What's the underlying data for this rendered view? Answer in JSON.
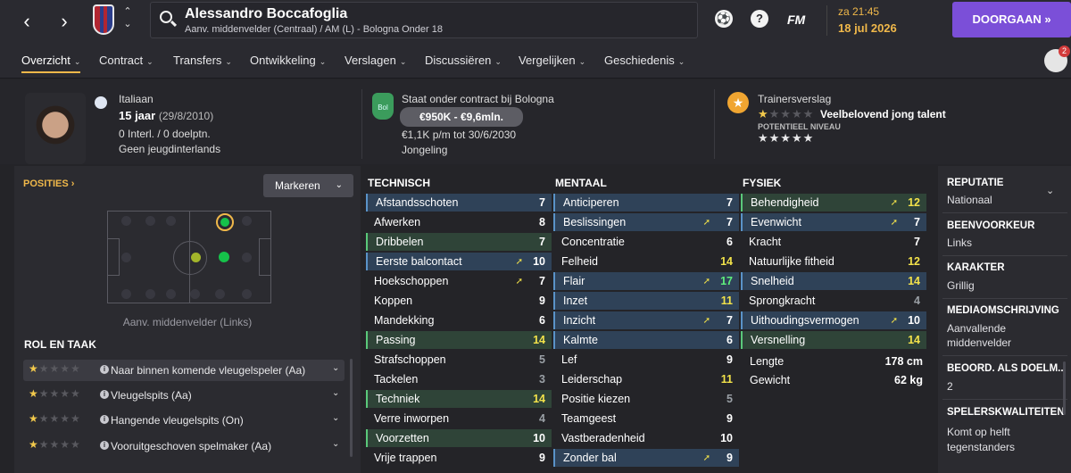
{
  "header": {
    "player_name": "Alessandro Boccafoglia",
    "player_sub": "Aanv. middenvelder (Centraal) / AM (L) - Bologna Onder 18",
    "fm_label": "FM",
    "time": "za 21:45",
    "date": "18 jul 2026",
    "continue_label": "DOORGAAN",
    "help_label": "?"
  },
  "menu": [
    {
      "label": "Overzicht"
    },
    {
      "label": "Contract"
    },
    {
      "label": "Transfers"
    },
    {
      "label": "Ontwikkeling"
    },
    {
      "label": "Verslagen"
    },
    {
      "label": "Discussiëren"
    },
    {
      "label": "Vergelijken"
    },
    {
      "label": "Geschiedenis"
    }
  ],
  "notifications_count": "2",
  "info": {
    "nationality": "Italiaan",
    "age": "15 jaar",
    "dob": "(29/8/2010)",
    "caps": "0 Interl. / 0 doelptn.",
    "youth": "Geen jeugdinterlands",
    "contract_status": "Staat onder contract bij Bologna",
    "club_short": "Bol",
    "value_range": "€950K - €9,6mln.",
    "wage": "€1,1K p/m tot 30/6/2030",
    "contract_type": "Jongeling",
    "coach_report_title": "Trainersverslag",
    "coach_report_text": "Veelbelovend jong talent",
    "potential_label": "POTENTIEEL NIVEAU",
    "current_ability_stars": 1.5,
    "potential_stars": 4.5
  },
  "positions": {
    "title": "POSITIES",
    "mark_button": "Markeren",
    "caption": "Aanv. middenvelder (Links)"
  },
  "roles": {
    "title": "ROL EN TAAK",
    "items": [
      {
        "label": "Naar binnen komende vleugelspeler (Aa)",
        "stars": 1.5
      },
      {
        "label": "Vleugelspits (Aa)",
        "stars": 1.5
      },
      {
        "label": "Hangende vleugelspits (On)",
        "stars": 1
      },
      {
        "label": "Vooruitgeschoven spelmaker (Aa)",
        "stars": 1
      }
    ]
  },
  "attributes": {
    "technical_title": "TECHNISCH",
    "mental_title": "MENTAAL",
    "physical_title": "FYSIEK",
    "technical": [
      {
        "name": "Afstandsschoten",
        "value": "7"
      },
      {
        "name": "Afwerken",
        "value": "8"
      },
      {
        "name": "Dribbelen",
        "value": "7"
      },
      {
        "name": "Eerste balcontact",
        "value": "10"
      },
      {
        "name": "Hoekschoppen",
        "value": "7"
      },
      {
        "name": "Koppen",
        "value": "9"
      },
      {
        "name": "Mandekking",
        "value": "6"
      },
      {
        "name": "Passing",
        "value": "14"
      },
      {
        "name": "Strafschoppen",
        "value": "5"
      },
      {
        "name": "Tackelen",
        "value": "3"
      },
      {
        "name": "Techniek",
        "value": "14"
      },
      {
        "name": "Verre inworpen",
        "value": "4"
      },
      {
        "name": "Voorzetten",
        "value": "10"
      },
      {
        "name": "Vrije trappen",
        "value": "9"
      }
    ],
    "mental": [
      {
        "name": "Anticiperen",
        "value": "7"
      },
      {
        "name": "Beslissingen",
        "value": "7"
      },
      {
        "name": "Concentratie",
        "value": "6"
      },
      {
        "name": "Felheid",
        "value": "14"
      },
      {
        "name": "Flair",
        "value": "17"
      },
      {
        "name": "Inzet",
        "value": "11"
      },
      {
        "name": "Inzicht",
        "value": "7"
      },
      {
        "name": "Kalmte",
        "value": "6"
      },
      {
        "name": "Lef",
        "value": "9"
      },
      {
        "name": "Leiderschap",
        "value": "11"
      },
      {
        "name": "Positie kiezen",
        "value": "5"
      },
      {
        "name": "Teamgeest",
        "value": "9"
      },
      {
        "name": "Vastberadenheid",
        "value": "10"
      },
      {
        "name": "Zonder bal",
        "value": "9"
      }
    ],
    "physical": [
      {
        "name": "Behendigheid",
        "value": "12"
      },
      {
        "name": "Evenwicht",
        "value": "7"
      },
      {
        "name": "Kracht",
        "value": "7"
      },
      {
        "name": "Natuurlijke fitheid",
        "value": "12"
      },
      {
        "name": "Snelheid",
        "value": "14"
      },
      {
        "name": "Sprongkracht",
        "value": "4"
      },
      {
        "name": "Uithoudingsvermogen",
        "value": "10"
      },
      {
        "name": "Versnelling",
        "value": "14"
      }
    ],
    "height_label": "Lengte",
    "height": "178 cm",
    "weight_label": "Gewicht",
    "weight": "62 kg"
  },
  "sidebar": {
    "reputation_title": "REPUTATIE",
    "reputation": "Nationaal",
    "foot_title": "BEENVOORKEUR",
    "foot": "Links",
    "character_title": "KARAKTER",
    "character": "Grillig",
    "media_title": "MEDIAOMSCHRIJVING",
    "media_line1": "Aanvallende",
    "media_line2": "middenvelder",
    "gk_title": "BEOORD. ALS DOELM...",
    "gk_value": "2",
    "qualities_title": "SPELERSKWALITEITEN",
    "quality_line1": "Komt op helft",
    "quality_line2": "tegenstanders"
  }
}
